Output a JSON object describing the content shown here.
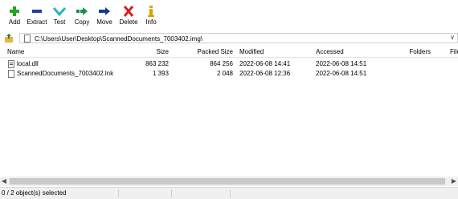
{
  "toolbar": {
    "buttons": [
      {
        "label": "Add"
      },
      {
        "label": "Extract"
      },
      {
        "label": "Test"
      },
      {
        "label": "Copy"
      },
      {
        "label": "Move"
      },
      {
        "label": "Delete"
      },
      {
        "label": "Info"
      }
    ]
  },
  "address": {
    "path": "C:\\Users\\User\\Desktop\\ScannedDocuments_7003402.img\\"
  },
  "columns": {
    "name": "Name",
    "size": "Size",
    "packed": "Packed Size",
    "modified": "Modified",
    "accessed": "Accessed",
    "folders": "Folders",
    "files": "Files"
  },
  "files": [
    {
      "name": "local.dll",
      "size": "863 232",
      "packed": "864 256",
      "modified": "2022-06-08 14:41",
      "accessed": "2022-06-08 14:51"
    },
    {
      "name": "ScannedDocuments_7003402.lnk",
      "size": "1 393",
      "packed": "2 048",
      "modified": "2022-06-08 12:36",
      "accessed": "2022-06-08 14:51"
    }
  ],
  "status": {
    "selected": "0 / 2 object(s) selected"
  },
  "colors": {
    "add": "#21a621",
    "extract": "#1f3f9e",
    "test": "#27b3c6",
    "copy": "#1a8f4a",
    "move": "#163a8f",
    "delete": "#d61f1f",
    "info": "#d6a300"
  }
}
